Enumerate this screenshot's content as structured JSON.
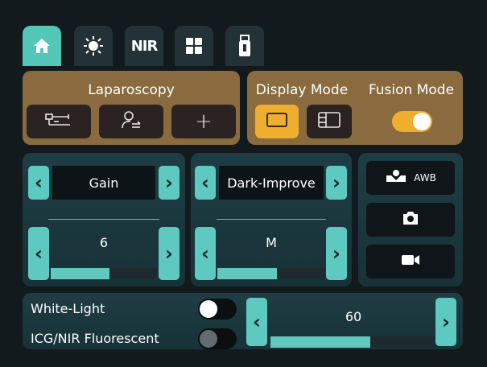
{
  "tabs": [
    {
      "icon": "home-icon",
      "active": true
    },
    {
      "icon": "light-icon",
      "active": false
    },
    {
      "icon": "nir-icon",
      "label": "NIR",
      "active": false
    },
    {
      "icon": "grid-icon",
      "active": false
    },
    {
      "icon": "usb-icon",
      "active": false
    }
  ],
  "laparoscopy": {
    "title": "Laparoscopy",
    "buttons": [
      {
        "icon": "scope-tool-icon"
      },
      {
        "icon": "user-switch-icon"
      },
      {
        "icon": "add-icon",
        "label": "+"
      }
    ]
  },
  "display_mode": {
    "title": "Display Mode",
    "options": [
      {
        "icon": "single-view-icon",
        "selected": true
      },
      {
        "icon": "split-view-icon",
        "selected": false
      }
    ]
  },
  "fusion_mode": {
    "title": "Fusion Mode",
    "enabled": true
  },
  "gain": {
    "title": "Gain",
    "value": "6",
    "level": 0.55
  },
  "dark_improve": {
    "title": "Dark-Improve",
    "value": "M",
    "level": 0.55
  },
  "side_controls": [
    {
      "icon": "awb-icon",
      "label": "AWB"
    },
    {
      "icon": "camera-icon"
    },
    {
      "icon": "record-icon"
    }
  ],
  "light_modes": [
    {
      "label": "White-Light",
      "enabled": true
    },
    {
      "label": "ICG/NIR Fluorescent",
      "enabled": false
    }
  ],
  "intensity": {
    "value": "60",
    "level": 0.6
  },
  "colors": {
    "accent": "#53c6b8",
    "orange_panel": "#8a6a3f",
    "toggle_on": "#f0ae2e"
  }
}
